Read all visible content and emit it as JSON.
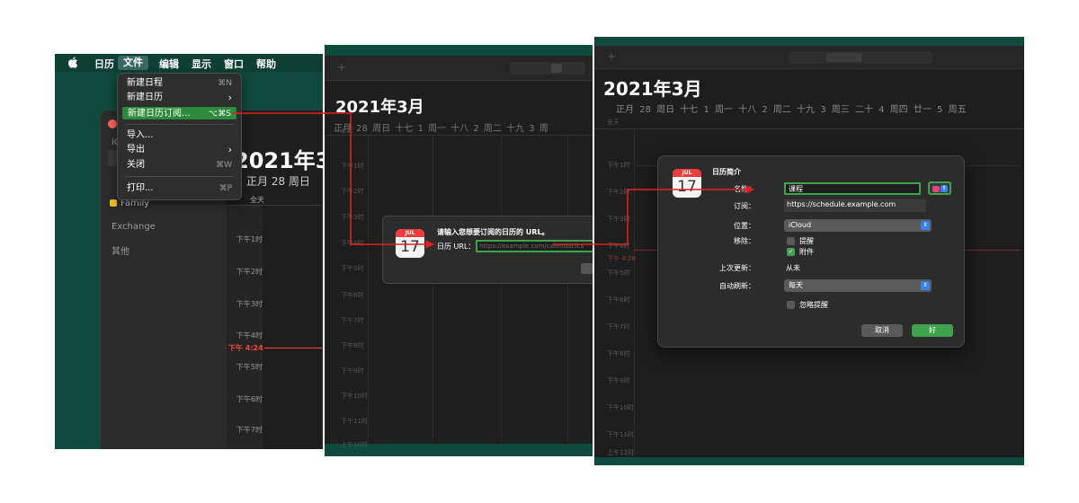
{
  "panel1": {
    "menubar": {
      "items": [
        "日历",
        "文件",
        "编辑",
        "显示",
        "窗口",
        "帮助"
      ]
    },
    "file_menu": {
      "new_event": {
        "label": "新建日程",
        "shortcut": "⌘N"
      },
      "new_calendar": {
        "label": "新建日历",
        "shortcut": "›"
      },
      "new_subscription": {
        "label": "新建日历订阅...",
        "shortcut": "⌥⌘S"
      },
      "import": {
        "label": "导入...",
        "shortcut": ""
      },
      "export": {
        "label": "导出",
        "shortcut": "›"
      },
      "close": {
        "label": "关闭",
        "shortcut": "⌘W"
      },
      "print": {
        "label": "打印...",
        "shortcut": "⌘P"
      }
    },
    "sidebar": {
      "ic": "iC",
      "family": "Family",
      "exchange": "Exchange",
      "other": "其他"
    },
    "calendar": {
      "title": "2021年3",
      "day_header": "正月  28 周日",
      "allday": "全天",
      "times": [
        "下午1时",
        "下午2时",
        "下午3时",
        "下午4时",
        "下午5时",
        "下午6时",
        "下午7时"
      ],
      "now": "下午 4:24"
    },
    "plus": "+"
  },
  "panel2": {
    "calendar": {
      "title": "2021年3月",
      "days": "正月 28 周日  十七    1 周一  十八    2 周二  十九    3 周",
      "times": [
        "全天",
        "下午1时",
        "下午2时",
        "下午3时",
        "下午4时",
        "下午5时",
        "下午6时",
        "下午7时",
        "下午8时",
        "下午9时",
        "下午10时",
        "下午11时",
        "上午10时"
      ]
    },
    "dialog": {
      "icon_month": "JUL",
      "icon_day": "17",
      "title": "请输入您想要订阅的日历的 URL。",
      "url_label": "日历 URL：",
      "url_placeholder": "https://example.com/calendar.ics"
    }
  },
  "panel3": {
    "calendar": {
      "title": "2021年3月",
      "days": "正月  28 周日  十七    1 周一  十八    2 周二  十九    3 周三  二十    4 周四  廿一    5 周五",
      "allday": "全天",
      "times": [
        "下午1时",
        "下午2时",
        "下午3时",
        "下午4时",
        "下午5时",
        "下午6时",
        "下午7时",
        "下午8时",
        "下午9时",
        "下午10时",
        "下午11时",
        "上午12时"
      ],
      "now": "下午 4:26"
    },
    "dialog": {
      "icon_month": "JUL",
      "icon_day": "17",
      "title": "日历简介",
      "name_label": "名称：",
      "name_value": "课程",
      "color": "#e0457b",
      "subscribe_label": "订阅：",
      "subscribe_value": "https://schedule.example.com",
      "location_label": "位置：",
      "location_value": "iCloud",
      "remove_label": "移除：",
      "remove_alerts": "提醒",
      "remove_attachments": "附件",
      "last_update_label": "上次更新：",
      "last_update_value": "从未",
      "auto_refresh_label": "自动刷新：",
      "auto_refresh_value": "每天",
      "ignore_alerts": "忽略提醒",
      "cancel": "取消",
      "ok": "好"
    }
  },
  "colors": {
    "accent_green": "#3fa34d",
    "annotation_red": "#e02020",
    "calendar_red": "#ef3b3b"
  }
}
